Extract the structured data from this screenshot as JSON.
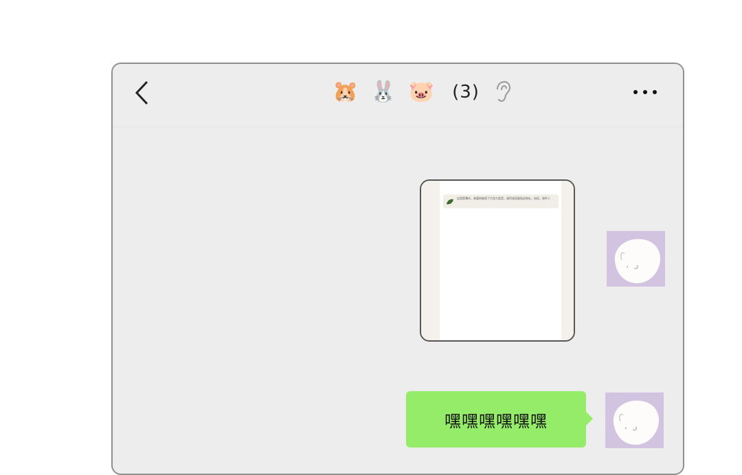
{
  "header": {
    "title_emojis": [
      "🐹",
      "🐰",
      "🐷"
    ],
    "member_count": "(3)",
    "icons": {
      "back": "chevron-left-icon",
      "earpiece": "ear-icon",
      "more": "more-dots-icon"
    }
  },
  "messages": [
    {
      "type": "image",
      "sender": "self",
      "image_caption": "这里是薄木，恭喜你抽到了巧克力奖奖，请尽快回复私信地址，电话，收件人"
    },
    {
      "type": "text",
      "sender": "self",
      "text": "嘿嘿嘿嘿嘿嘿"
    }
  ],
  "colors": {
    "chat_background": "#ededed",
    "bubble_self": "#95ec69",
    "avatar_background": "#d2c4e1"
  }
}
